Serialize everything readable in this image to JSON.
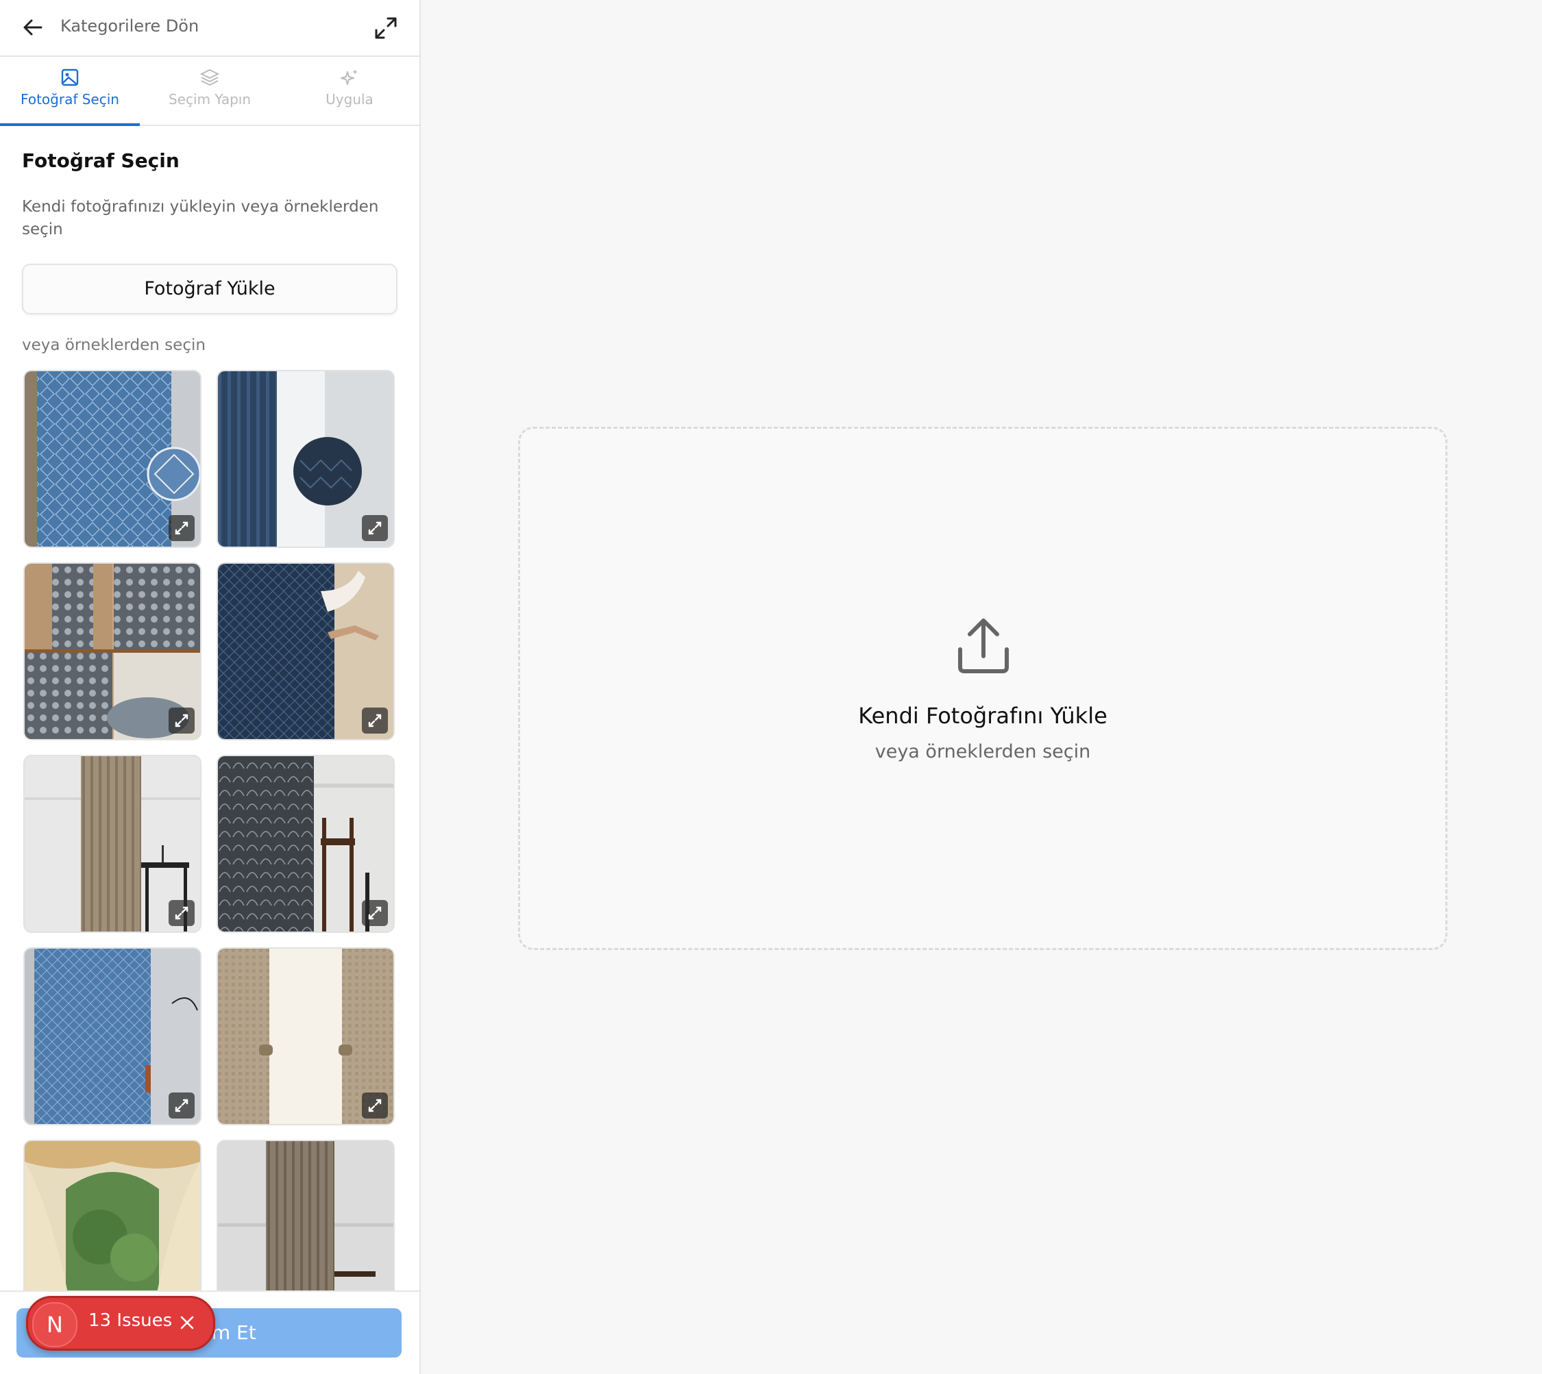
{
  "header": {
    "back_label": "Kategorilere Dön"
  },
  "tabs": [
    {
      "label": "Fotoğraf Seçin",
      "icon": "image-icon",
      "active": true
    },
    {
      "label": "Seçim Yapın",
      "icon": "layers-icon",
      "active": false
    },
    {
      "label": "Uygula",
      "icon": "sparkles-icon",
      "active": false
    }
  ],
  "panel": {
    "title": "Fotoğraf Seçin",
    "description": "Kendi fotoğrafınızı yükleyin veya örneklerden seçin",
    "upload_button": "Fotoğraf Yükle",
    "examples_label": "veya örneklerden seçin"
  },
  "examples": [
    {
      "id": "blue-diamond-curtain"
    },
    {
      "id": "navy-chevron-curtain-sheer"
    },
    {
      "id": "damask-collage"
    },
    {
      "id": "navy-curtain-hand"
    },
    {
      "id": "beige-stripe-curtain"
    },
    {
      "id": "grey-damask-curtain"
    },
    {
      "id": "blue-pattern-curtain"
    },
    {
      "id": "beige-tieback-curtain"
    },
    {
      "id": "valance-drape-garden"
    },
    {
      "id": "taupe-stripe-curtain"
    }
  ],
  "footer": {
    "confirm_label": "Devam Et"
  },
  "issues": {
    "logo": "N",
    "label": "13 Issues"
  },
  "dropzone": {
    "icon": "upload-icon",
    "title": "Kendi Fotoğrafını Yükle",
    "subtitle": "veya örneklerden seçin"
  },
  "colors": {
    "accent": "#1a6fd0",
    "confirm": "#7db3ee",
    "issues": "#e03a3a"
  }
}
